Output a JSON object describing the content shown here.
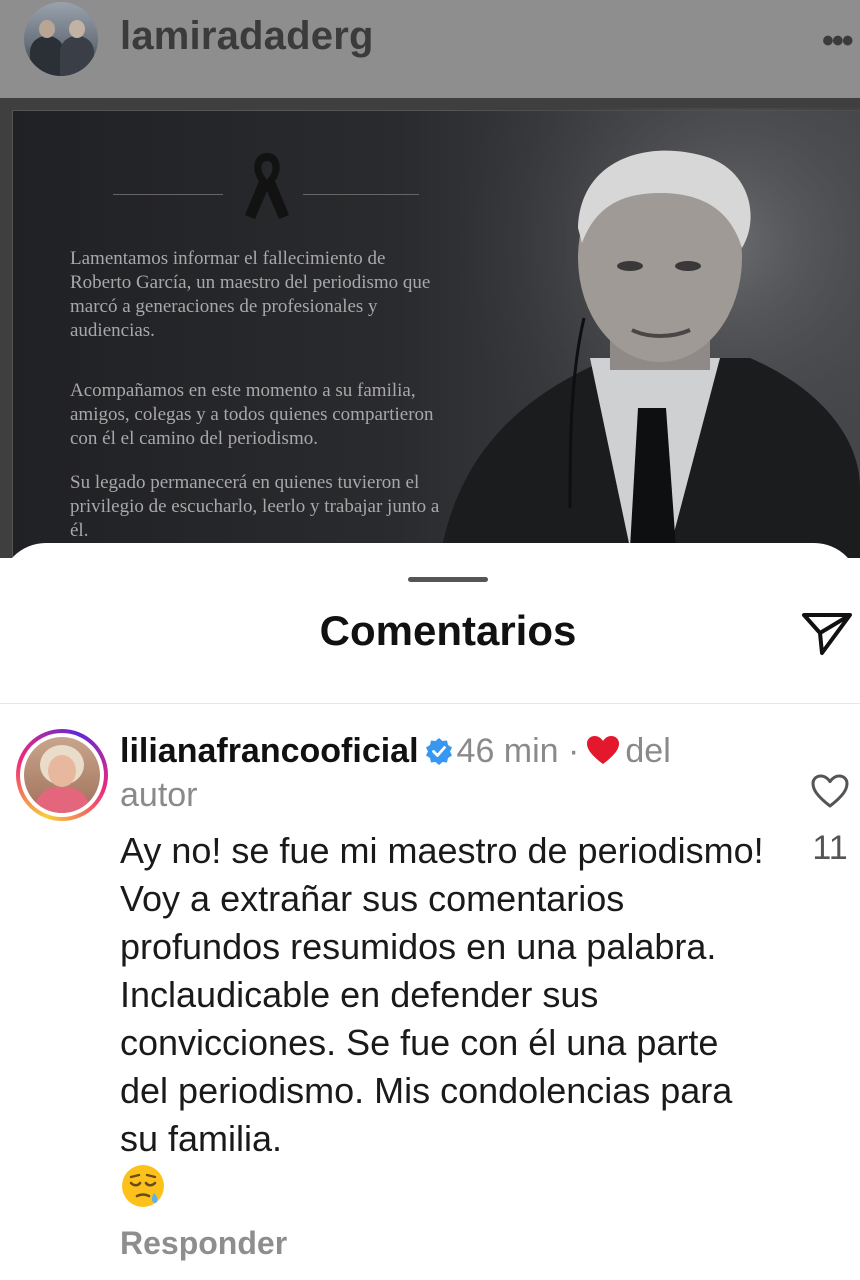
{
  "header": {
    "username": "lamiradaderg",
    "more_glyph": "•••"
  },
  "post": {
    "paragraph1": "Lamentamos informar el fallecimiento de Roberto García, un maestro del periodismo que marcó a generaciones de profesionales y audiencias.",
    "paragraph2": "Acompañamos en este momento a su familia, amigos, colegas y a todos quienes compartieron con él el camino del periodismo.",
    "paragraph3": "Su legado permanecerá en quienes tuvieron el privilegio de escucharlo, leerlo y trabajar junto a él."
  },
  "sheet": {
    "title": "Comentarios"
  },
  "comment": {
    "username": "lilianafrancooficial",
    "time": "46 min",
    "separator": "·",
    "author_like_text": "del autor",
    "text": "Ay no! se fue mi maestro de periodismo! Voy a extrañar sus comentarios profundos resumidos en una palabra. Inclaudicable en defender sus convicciones. Se fue con él una parte del periodismo. Mis condolencias para su familia.",
    "reply_label": "Responder",
    "like_count": "11"
  },
  "icons": {
    "verified": "verified-badge-icon",
    "author_heart": "heart-filled-icon",
    "like": "heart-outline-icon",
    "share": "paper-plane-icon",
    "emoji": "sleepy-face-emoji"
  },
  "colors": {
    "verified": "#3897f0",
    "heart": "#e3182d"
  }
}
